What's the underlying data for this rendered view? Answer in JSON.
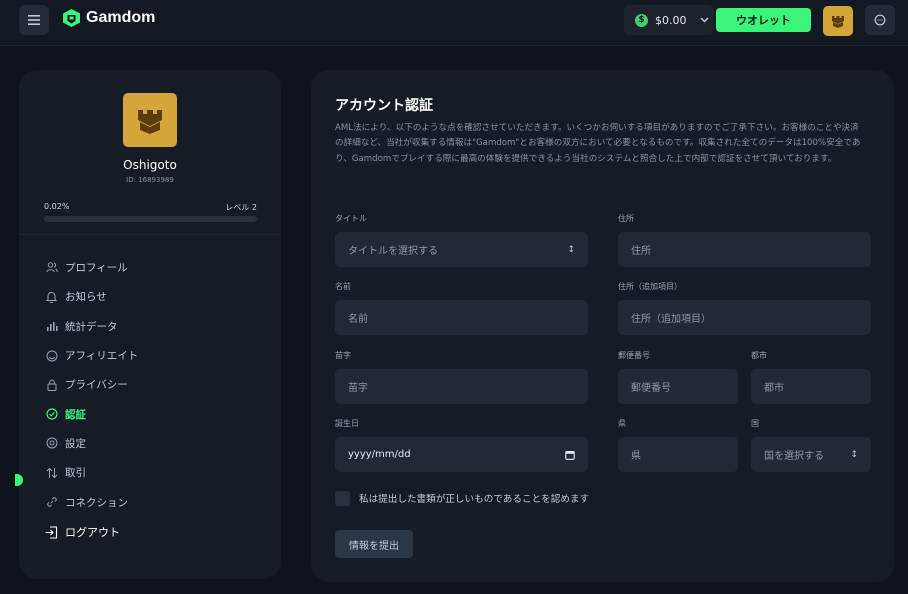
{
  "header": {
    "brand": "Gamdom",
    "balance": "$0.00",
    "coin_symbol": "$",
    "wallet_label": "ウオレット",
    "accent": "#3bf57a"
  },
  "sidebar": {
    "username": "Oshigoto",
    "user_id": "ID: 16893989",
    "progress_text": "0.02%",
    "progress_value": 0.0002,
    "level": "レベル 2",
    "items": [
      {
        "label": "プロフィール",
        "icon": "users-icon"
      },
      {
        "label": "お知らせ",
        "icon": "bell-icon"
      },
      {
        "label": "統計データ",
        "icon": "bar-chart-icon"
      },
      {
        "label": "アフィリエイト",
        "icon": "smile-icon"
      },
      {
        "label": "プライバシー",
        "icon": "lock-icon"
      },
      {
        "label": "認証",
        "icon": "check-circle-icon",
        "active": true
      },
      {
        "label": "設定",
        "icon": "gear-icon"
      },
      {
        "label": "取引",
        "icon": "transfer-icon"
      },
      {
        "label": "コネクション",
        "icon": "link-icon"
      }
    ],
    "logout": "ログアウト"
  },
  "form": {
    "title": "アカウント認証",
    "description": "AML法により、以下のような点を確認させていただきます。いくつかお伺いする項目がありますのでご了承下さい。お客様のことや決済の詳細など、当社が収集する情報は\"Gamdom\"とお客様の双方において必要となるものです。収集された全てのデータは100%安全であり、Gamdomでプレイする際に最高の体験を提供できるよう当社のシステムと照合した上で内部で認証をさせて頂いております。",
    "title_field": {
      "label": "タイトル",
      "placeholder": "タイトルを選択する"
    },
    "first_name": {
      "label": "名前",
      "placeholder": "名前"
    },
    "last_name": {
      "label": "苗字",
      "placeholder": "苗字"
    },
    "birthdate": {
      "label": "誕生日",
      "value": "yyyy/mm/dd"
    },
    "address": {
      "label": "住所",
      "placeholder": "住所"
    },
    "address2": {
      "label": "住所（追加項目）",
      "placeholder": "住所（追加項目）"
    },
    "postal": {
      "label": "郵便番号",
      "placeholder": "郵便番号"
    },
    "city": {
      "label": "都市",
      "placeholder": "都市"
    },
    "prefecture": {
      "label": "県",
      "placeholder": "県"
    },
    "country": {
      "label": "国",
      "placeholder": "国を選択する"
    },
    "confirm_label": "私は提出した書類が正しいものであることを認めます",
    "submit_label": "情報を提出"
  }
}
